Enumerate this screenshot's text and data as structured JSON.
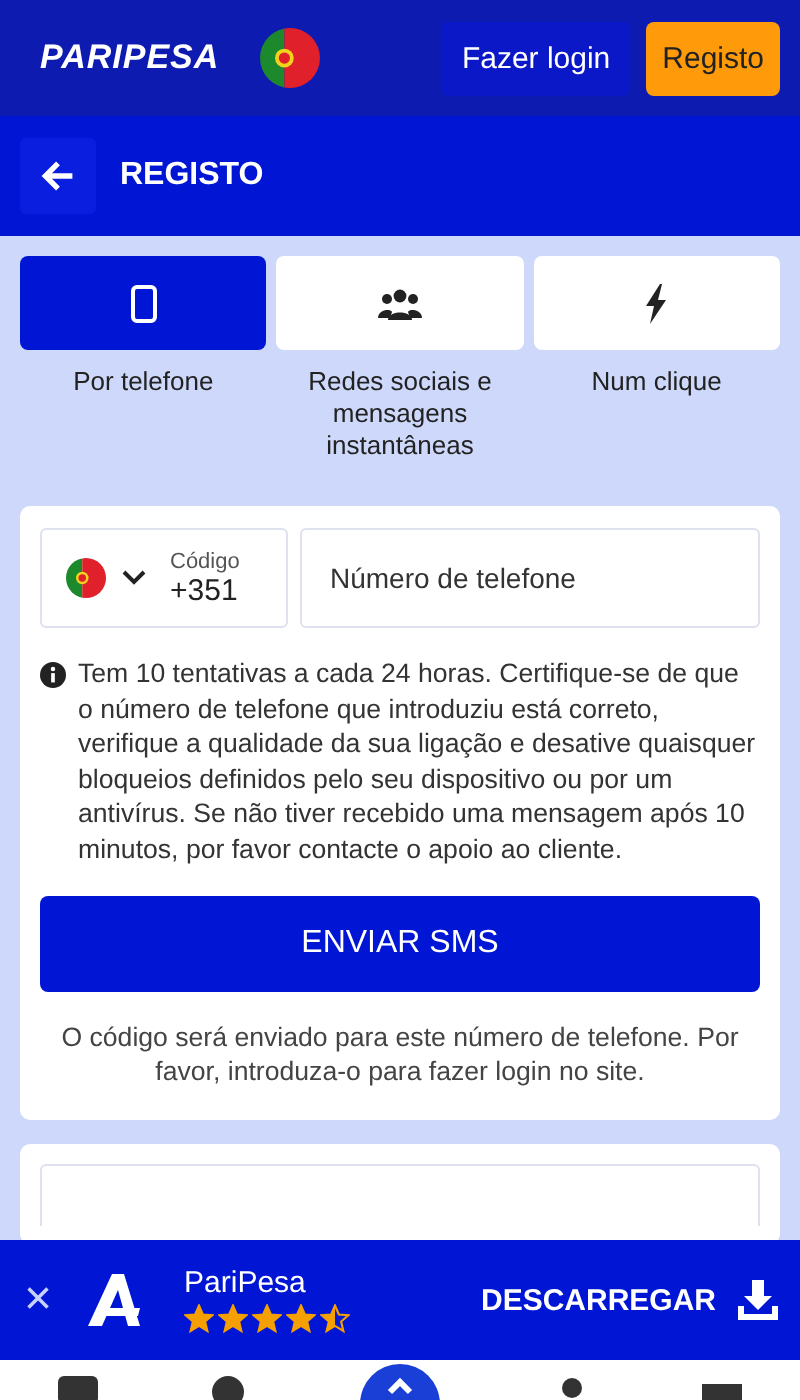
{
  "header": {
    "logo": "PARIPESA",
    "login_button": "Fazer login",
    "register_button": "Registo"
  },
  "subheader": {
    "title": "REGISTO"
  },
  "tabs": [
    {
      "label": "Por telefone",
      "kind": "phone",
      "selected": true
    },
    {
      "label": "Redes sociais e mensagens instantâneas",
      "kind": "people",
      "selected": false
    },
    {
      "label": "Num clique",
      "kind": "bolt",
      "selected": false
    }
  ],
  "phone_form": {
    "code_label": "Código",
    "code_value": "+351",
    "phone_placeholder": "Número de telefone",
    "info": "Tem 10 tentativas a cada 24 horas. Certifique-se de que o número de telefone que introduziu está correto, verifique a qualidade da sua ligação e desative quaisquer bloqueios definidos pelo seu dispositivo ou por um antivírus. Se não tiver recebido uma mensagem após 10 minutos, por favor contacte o apoio ao cliente.",
    "send_button": "ENVIAR SMS",
    "note": "O código será enviado para este número de telefone. Por favor, introduza-o para fazer login no site."
  },
  "app_banner": {
    "close": "×",
    "name": "PariPesa",
    "stars": 4.5,
    "download_button": "DESCARREGAR"
  }
}
